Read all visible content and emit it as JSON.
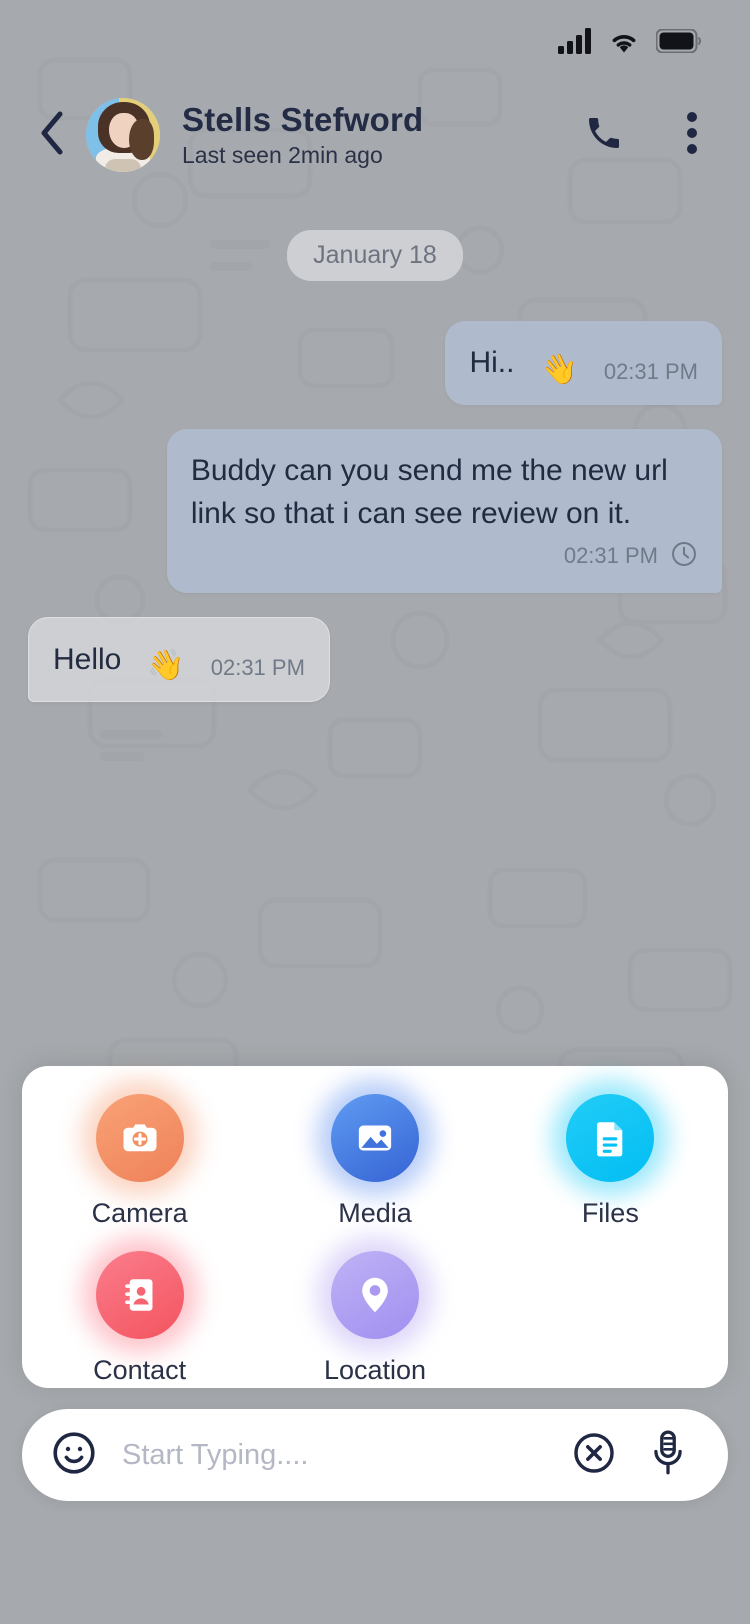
{
  "statusbar": {
    "signal_icon": "signal-bars-icon",
    "wifi_icon": "wifi-icon",
    "battery_icon": "battery-full-icon"
  },
  "header": {
    "back_icon": "chevron-left-icon",
    "avatar_alt": "contact-avatar",
    "contact_name": "Stells Stefword",
    "last_seen": "Last seen 2min ago",
    "call_icon": "phone-icon",
    "menu_icon": "more-vertical-icon"
  },
  "chat": {
    "date_label": "January 18",
    "messages": [
      {
        "direction": "out",
        "text": "Hi..",
        "emoji": "👋",
        "time": "02:31 PM",
        "status_icon": ""
      },
      {
        "direction": "out",
        "text": "Buddy can you send me the new url link so that i can see review on it.",
        "emoji": "",
        "time": "02:31 PM",
        "status_icon": "clock-pending-icon"
      },
      {
        "direction": "in",
        "text": "Hello",
        "emoji": "👋",
        "time": "02:31 PM",
        "status_icon": ""
      }
    ]
  },
  "attachment_sheet": {
    "items": [
      {
        "label": "Camera",
        "icon": "camera-icon",
        "color": "#f2905f"
      },
      {
        "label": "Media",
        "icon": "image-icon",
        "color": "#3f73de"
      },
      {
        "label": "Files",
        "icon": "document-icon",
        "color": "#06c1f4"
      },
      {
        "label": "Contact",
        "icon": "address-book-icon",
        "color": "#f66571"
      },
      {
        "label": "Location",
        "icon": "map-pin-icon",
        "color": "#ab99f1"
      }
    ]
  },
  "composer": {
    "emoji_icon": "smiley-face-icon",
    "placeholder": "Start Typing....",
    "value": "",
    "close_icon": "close-circle-icon",
    "mic_icon": "microphone-icon"
  }
}
